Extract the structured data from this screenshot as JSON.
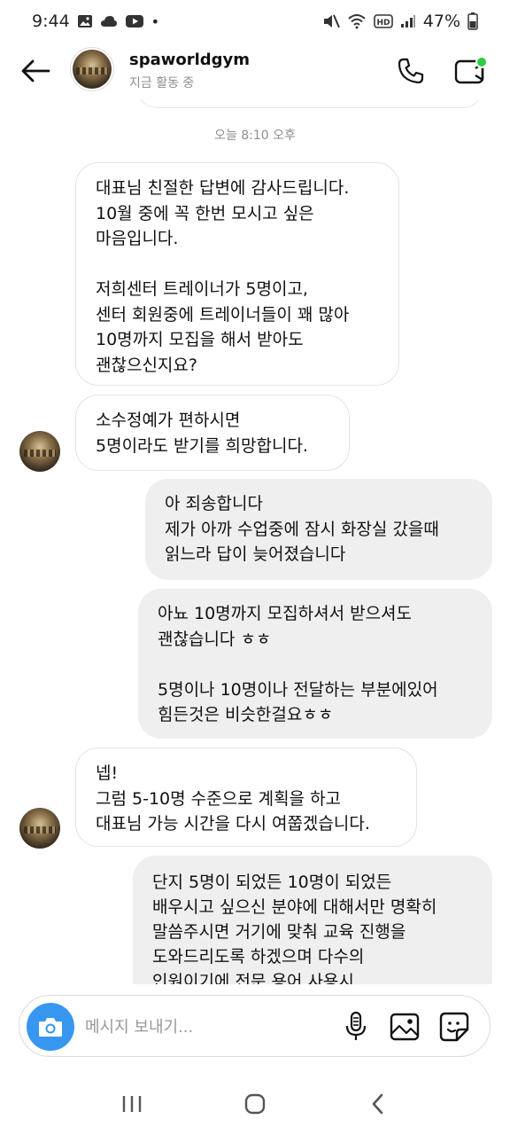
{
  "status_bar": {
    "time": "9:44",
    "battery": "47%",
    "dot": "•"
  },
  "header": {
    "username": "spaworldgym",
    "activity": "지금 활동 중"
  },
  "chat": {
    "timestamp": "오늘 8:10 오후",
    "messages": [
      {
        "side": "in",
        "text": "대표님 친절한 답변에 감사드립니다.\n10월 중에 꼭 한번 모시고 싶은\n마음입니다.\n\n저희센터 트레이너가 5명이고,\n센터 회원중에 트레이너들이 꽤 많아\n10명까지 모집을 해서 받아도\n괜찮으신지요?"
      },
      {
        "side": "in",
        "text": "소수정예가 편하시면\n5명이라도 받기를 희망합니다."
      },
      {
        "side": "out",
        "text": "아 죄송합니다\n제가 아까 수업중에 잠시 화장실 갔을때\n읽느라 답이 늦어졌습니다"
      },
      {
        "side": "out",
        "text": "아뇨  10명까지 모집하셔서 받으셔도\n괜찮습니다 ㅎㅎ\n\n5명이나 10명이나 전달하는 부분에있어\n힘든것은 비슷한걸요ㅎㅎ"
      },
      {
        "side": "in",
        "text": "넵!\n그럼 5-10명 수준으로 계획을 하고\n대표님 가능 시간을 다시 여쭙겠습니다."
      },
      {
        "side": "out",
        "text": "단지 5명이 되었든 10명이 되었든\n배우시고 싶으신 분야에 대해서만 명확히\n말씀주시면 거기에 맞춰 교육 진행을\n도와드리도록 하겠으며 다수의\n인원이기에 전문 용어 사용시"
      }
    ]
  },
  "composer": {
    "placeholder": "메시지 보내기..."
  },
  "icons": {
    "camera": "camera-icon",
    "mic": "microphone-icon",
    "gallery": "gallery-icon",
    "sticker": "sticker-icon",
    "back": "arrow-left-icon",
    "call": "phone-icon",
    "video": "video-call-icon"
  },
  "colors": {
    "accent": "#3797f0",
    "online_dot": "#2ecc40",
    "outgoing_bubble": "#efefef",
    "incoming_border": "#e3e3e3"
  }
}
